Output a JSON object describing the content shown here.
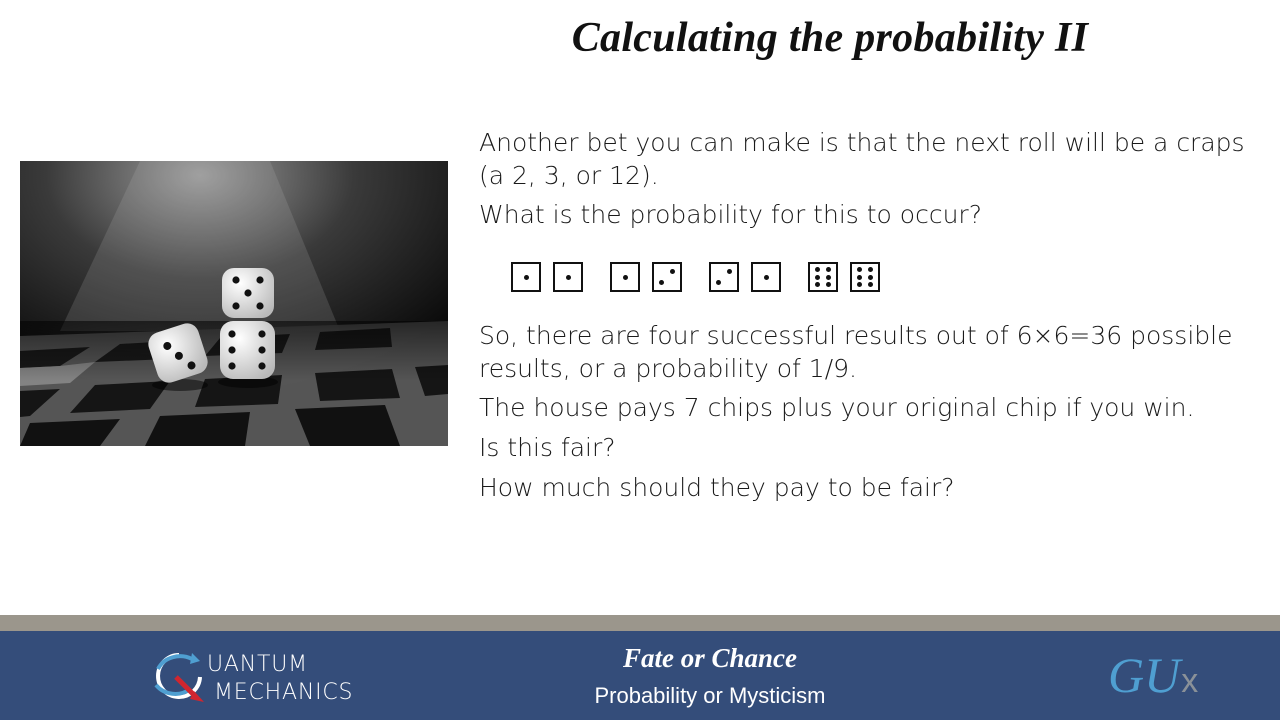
{
  "slide": {
    "title": "Calculating the probability II",
    "paragraphs": [
      "Another bet you can make is that the next roll will be a craps (a 2, 3, or 12).",
      "What is the probability for this to occur?",
      "So, there are four successful results out of 6×6=36 possible results, or a probability of 1/9.",
      "The house pays 7 chips plus your original chip if you win.",
      "Is this fair?",
      "How much should they pay to be fair?"
    ],
    "dice_pairs": [
      [
        1,
        1
      ],
      [
        1,
        2
      ],
      [
        2,
        1
      ],
      [
        6,
        6
      ]
    ]
  },
  "footer": {
    "logo_line1": "UANTUM",
    "logo_line2": "MECHANICS",
    "course_title": "Fate or Chance",
    "course_subtitle": "Probability or Mysticism",
    "brand_gu": "GU",
    "brand_x": "x"
  },
  "colors": {
    "footer_bg": "#344d7a",
    "footer_strip": "#9b968c",
    "brand_blue": "#4f9fd1",
    "logo_red": "#d0262f"
  },
  "icons": [
    "dice-photo",
    "quantum-logo-icon"
  ]
}
